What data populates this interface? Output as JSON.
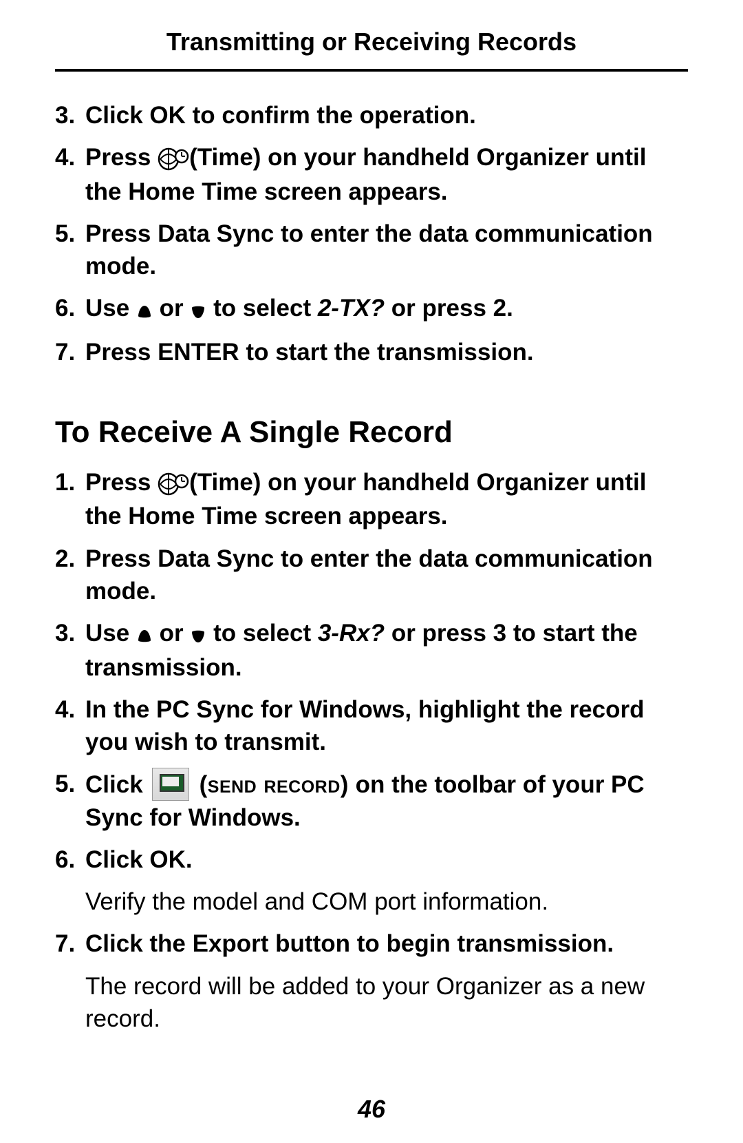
{
  "header": "Transmitting or Receiving Records",
  "pageNumber": "46",
  "top": {
    "s3": {
      "n": "3.",
      "t": "Click OK  to confirm the operation."
    },
    "s4": {
      "n": "4.",
      "pre": "Press ",
      "post": "(Time) on your handheld Organizer until the Home Time screen appears."
    },
    "s5": {
      "n": "5.",
      "t": "Press Data Sync to enter the data communication mode."
    },
    "s6": {
      "n": "6.",
      "pre": "Use ",
      "mid": " or ",
      "post1": " to select ",
      "tx": "2-TX?",
      "post2": " or press 2."
    },
    "s7": {
      "n": "7.",
      "t": "Press ENTER to start the transmission."
    }
  },
  "sectionTitle": "To Receive A Single Record",
  "rx": {
    "s1": {
      "n": "1.",
      "pre": "Press ",
      "post": "(Time) on your handheld Organizer until the Home Time screen appears."
    },
    "s2": {
      "n": "2.",
      "t": "Press Data Sync to enter the data communication mode."
    },
    "s3": {
      "n": "3.",
      "pre": "Use ",
      "mid": " or ",
      "post1": " to select ",
      "rxlabel": "3-Rx?",
      "post2": " or press 3 to start the transmission."
    },
    "s4": {
      "n": "4.",
      "t": "In the PC Sync for Windows, highlight the record you wish to transmit."
    },
    "s5": {
      "n": "5.",
      "pre": "Click ",
      "sc": " (send record)",
      "post": " on the toolbar of your PC Sync for Windows."
    },
    "s6": {
      "n": "6.",
      "t": "Click OK."
    },
    "s6note": "Verify the model and COM port information.",
    "s7": {
      "n": "7.",
      "t": "Click the Export button to begin transmission."
    },
    "s7note": "The record will be added to your Organizer as a new record."
  }
}
